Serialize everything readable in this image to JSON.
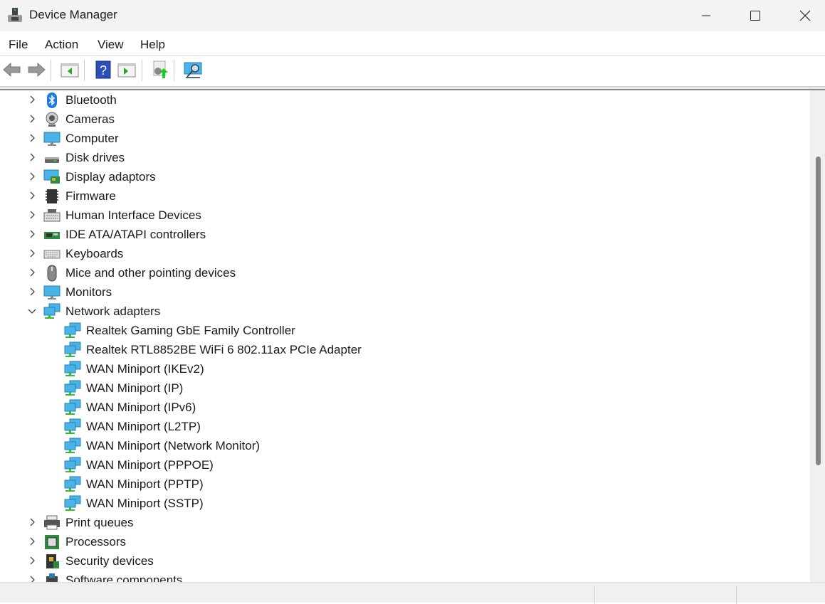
{
  "window": {
    "title": "Device Manager"
  },
  "menu": [
    "File",
    "Action",
    "View",
    "Help"
  ],
  "toolbar": [
    "back-icon",
    "forward-icon",
    "show-hide-console-tree-icon",
    "help-icon",
    "show-action-pane-icon",
    "update-driver-icon",
    "scan-hardware-icon"
  ],
  "tree": [
    {
      "label": "Bluetooth",
      "icon": "bluetooth",
      "expanded": false
    },
    {
      "label": "Cameras",
      "icon": "camera",
      "expanded": false
    },
    {
      "label": "Computer",
      "icon": "monitor",
      "expanded": false
    },
    {
      "label": "Disk drives",
      "icon": "disk",
      "expanded": false
    },
    {
      "label": "Display adaptors",
      "icon": "display-adapter",
      "expanded": false
    },
    {
      "label": "Firmware",
      "icon": "chip",
      "expanded": false
    },
    {
      "label": "Human Interface Devices",
      "icon": "hid",
      "expanded": false
    },
    {
      "label": "IDE ATA/ATAPI controllers",
      "icon": "ide",
      "expanded": false
    },
    {
      "label": "Keyboards",
      "icon": "keyboard",
      "expanded": false
    },
    {
      "label": "Mice and other pointing devices",
      "icon": "mouse",
      "expanded": false
    },
    {
      "label": "Monitors",
      "icon": "monitor",
      "expanded": false
    },
    {
      "label": "Network adapters",
      "icon": "network",
      "expanded": true,
      "children": [
        "Realtek Gaming GbE Family Controller",
        "Realtek RTL8852BE WiFi 6 802.11ax PCIe Adapter",
        "WAN Miniport (IKEv2)",
        "WAN Miniport (IP)",
        "WAN Miniport (IPv6)",
        "WAN Miniport (L2TP)",
        "WAN Miniport (Network Monitor)",
        "WAN Miniport (PPPOE)",
        "WAN Miniport (PPTP)",
        "WAN Miniport (SSTP)"
      ]
    },
    {
      "label": "Print queues",
      "icon": "printer",
      "expanded": false
    },
    {
      "label": "Processors",
      "icon": "processor",
      "expanded": false
    },
    {
      "label": "Security devices",
      "icon": "security",
      "expanded": false
    },
    {
      "label": "Software components",
      "icon": "software",
      "expanded": false
    }
  ]
}
